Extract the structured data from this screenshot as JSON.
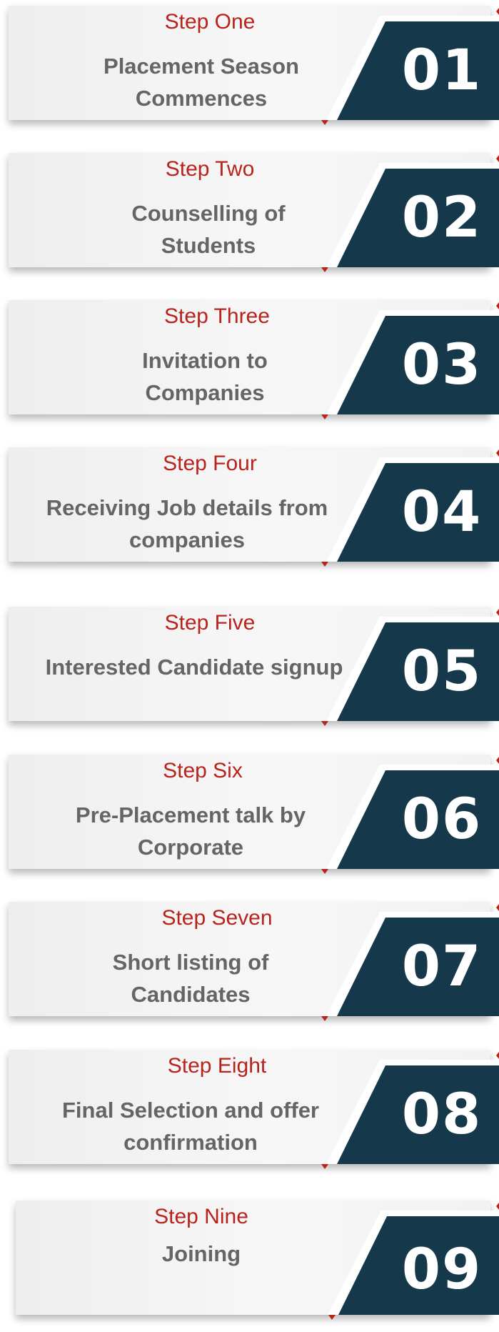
{
  "colors": {
    "accent_red": "#b8231c",
    "badge_navy": "#15394a",
    "title_grey": "#656565",
    "card_bg": "#f2f2f2"
  },
  "steps": [
    {
      "label": "Step One",
      "title": "Placement Season Commences",
      "number": "01"
    },
    {
      "label": "Step Two",
      "title": "Counselling of Students",
      "number": "02"
    },
    {
      "label": "Step Three",
      "title": "Invitation to Companies",
      "number": "03"
    },
    {
      "label": "Step Four",
      "title": "Receiving Job details from companies",
      "number": "04"
    },
    {
      "label": "Step Five",
      "title": "Interested Candidate signup",
      "number": "05"
    },
    {
      "label": "Step Six",
      "title": "Pre-Placement talk by Corporate",
      "number": "06"
    },
    {
      "label": "Step Seven",
      "title": "Short listing of Candidates",
      "number": "07"
    },
    {
      "label": "Step Eight",
      "title": "Final Selection and offer confirmation",
      "number": "08"
    },
    {
      "label": "Step Nine",
      "title": "Joining",
      "number": "09"
    }
  ]
}
